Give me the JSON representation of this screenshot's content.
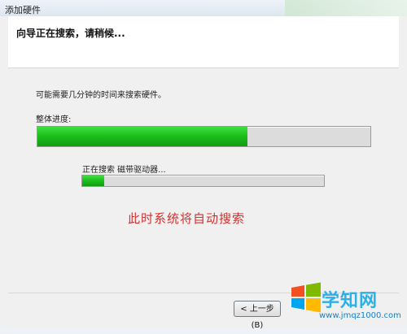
{
  "window": {
    "title": "添加硬件"
  },
  "header": {
    "heading": "向导正在搜索，请稍候..."
  },
  "main": {
    "info_text": "可能需要几分钟的时间来搜索硬件。",
    "overall_label": "整体进度:",
    "overall_progress": 0.63,
    "searching_text": "正在搜索 磁带驱动器...",
    "sub_progress": 0.09
  },
  "annotation": {
    "text": "此时系统将自动搜索",
    "color": "#d0322f"
  },
  "footer": {
    "back_label": "< 上一步(B)"
  },
  "watermark": {
    "brand": "学知网",
    "url": "www.jmqz1000.com"
  },
  "colors": {
    "progress_green": "#1bbd1b"
  }
}
